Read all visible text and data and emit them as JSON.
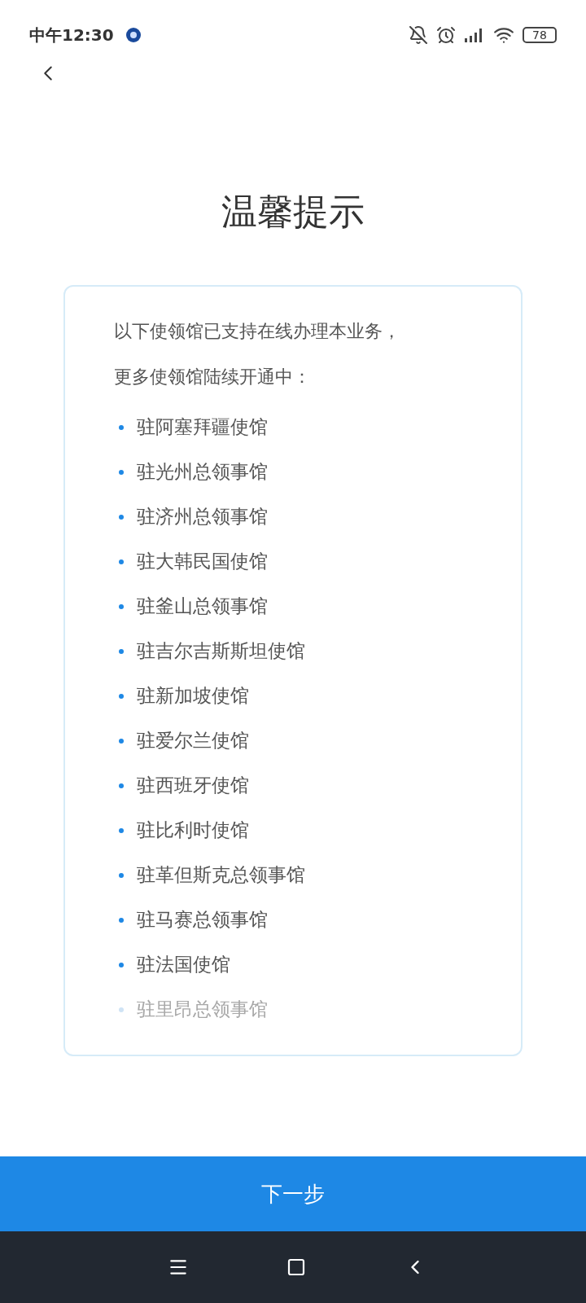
{
  "status_bar": {
    "time": "中午12:30",
    "battery": "78"
  },
  "title": "温馨提示",
  "notice": {
    "intro": [
      "以下使领馆已支持在线办理本业务，",
      "更多使领馆陆续开通中："
    ],
    "items": [
      {
        "label": "驻阿塞拜疆使馆",
        "faded": false
      },
      {
        "label": "驻光州总领事馆",
        "faded": false
      },
      {
        "label": "驻济州总领事馆",
        "faded": false
      },
      {
        "label": "驻大韩民国使馆",
        "faded": false
      },
      {
        "label": "驻釜山总领事馆",
        "faded": false
      },
      {
        "label": "驻吉尔吉斯斯坦使馆",
        "faded": false
      },
      {
        "label": "驻新加坡使馆",
        "faded": false
      },
      {
        "label": "驻爱尔兰使馆",
        "faded": false
      },
      {
        "label": "驻西班牙使馆",
        "faded": false
      },
      {
        "label": "驻比利时使馆",
        "faded": false
      },
      {
        "label": "驻革但斯克总领事馆",
        "faded": false
      },
      {
        "label": "驻马赛总领事馆",
        "faded": false
      },
      {
        "label": "驻法国使馆",
        "faded": false
      },
      {
        "label": "驻里昂总领事馆",
        "faded": true
      }
    ]
  },
  "next_button": "下一步"
}
